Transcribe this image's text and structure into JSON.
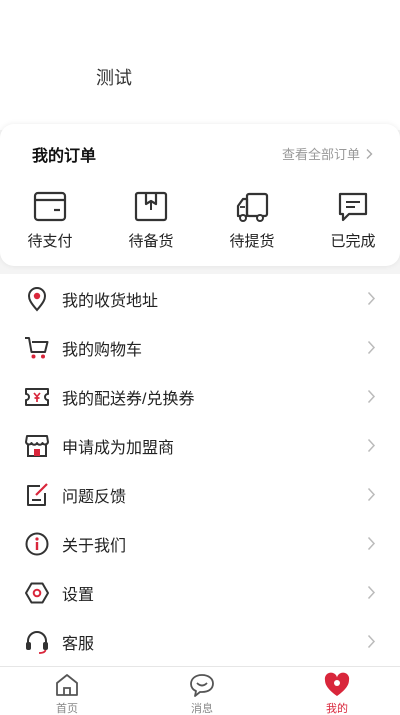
{
  "profile": {
    "name": "测试"
  },
  "orders": {
    "title": "我的订单",
    "view_all": "查看全部订单",
    "items": [
      {
        "label": "待支付",
        "icon": "wallet-icon"
      },
      {
        "label": "待备货",
        "icon": "package-icon"
      },
      {
        "label": "待提货",
        "icon": "truck-icon"
      },
      {
        "label": "已完成",
        "icon": "message-check-icon"
      }
    ]
  },
  "menu": {
    "items": [
      {
        "label": "我的收货地址",
        "icon": "location-pin-icon"
      },
      {
        "label": "我的购物车",
        "icon": "cart-icon"
      },
      {
        "label": "我的配送券/兑换券",
        "icon": "coupon-icon"
      },
      {
        "label": "申请成为加盟商",
        "icon": "store-icon"
      },
      {
        "label": "问题反馈",
        "icon": "feedback-icon"
      },
      {
        "label": "关于我们",
        "icon": "info-icon"
      },
      {
        "label": "设置",
        "icon": "settings-icon"
      },
      {
        "label": "客服",
        "icon": "headset-icon"
      }
    ]
  },
  "tabbar": {
    "items": [
      {
        "label": "首页",
        "icon": "home-icon"
      },
      {
        "label": "消息",
        "icon": "chat-icon"
      },
      {
        "label": "我的",
        "icon": "profile-icon"
      }
    ],
    "active_index": 2
  },
  "colors": {
    "accent": "#d9263b",
    "icon_stroke": "#333333",
    "muted": "#999999"
  }
}
